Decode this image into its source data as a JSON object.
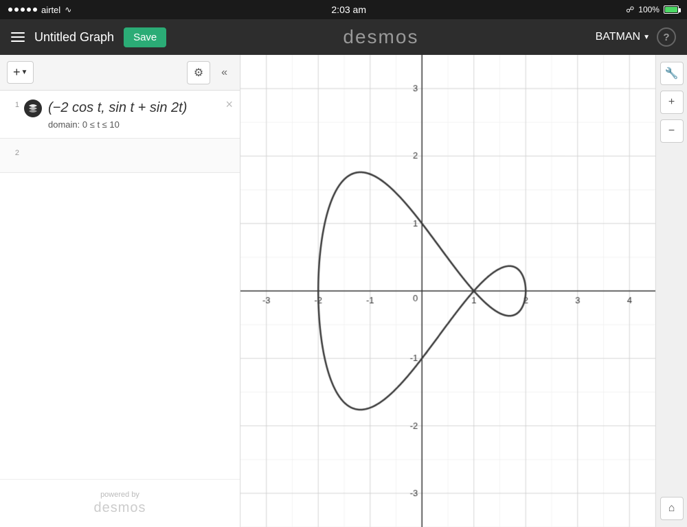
{
  "statusBar": {
    "carrier": "airtel",
    "time": "2:03 am",
    "bluetooth": "BT",
    "battery": "100%"
  },
  "nav": {
    "title": "Untitled Graph",
    "saveLabel": "Save",
    "brand": "desmos",
    "user": "BATMAN",
    "helpLabel": "?"
  },
  "toolbar": {
    "addLabel": "+",
    "collapseLabel": "«"
  },
  "expressions": [
    {
      "rowNum": "1",
      "formula": "(−2 cos t, sin t + sin 2t)",
      "domain": "domain:  0 ≤ t ≤ 10",
      "hasClose": true
    },
    {
      "rowNum": "2",
      "formula": "",
      "domain": "",
      "hasClose": false
    }
  ],
  "poweredBy": {
    "line1": "powered by",
    "line2": "desmos"
  },
  "graph": {
    "xMin": -3,
    "xMax": 4,
    "yMin": -3,
    "yMax": 3,
    "xLabels": [
      -3,
      -2,
      -1,
      0,
      1,
      2,
      3,
      4
    ],
    "yLabels": [
      -3,
      -2,
      -1,
      1,
      2,
      3
    ]
  },
  "tools": {
    "wrench": "🔧",
    "zoomIn": "+",
    "zoomOut": "−",
    "home": "⌂"
  }
}
